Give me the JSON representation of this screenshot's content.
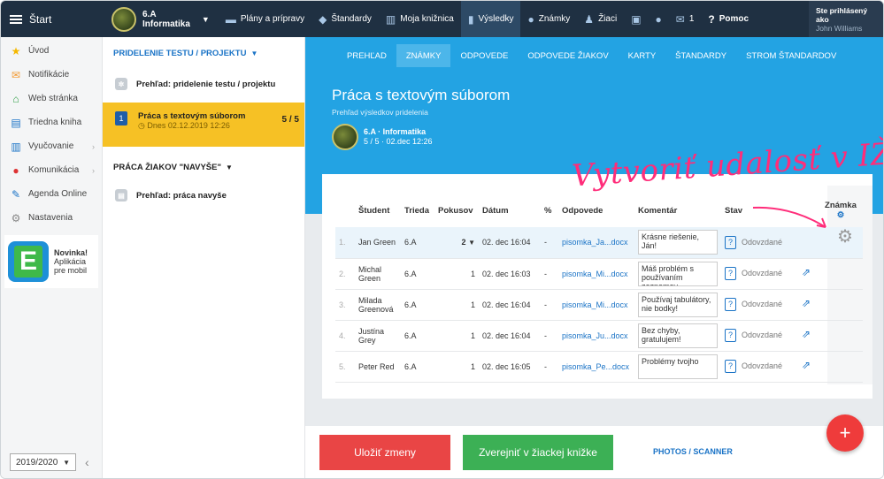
{
  "topbar": {
    "start_label": "Štart",
    "class_code": "6.A",
    "class_subject": "Informatika",
    "items": [
      {
        "label": "Plány a prípravy",
        "icon": "plans-icon"
      },
      {
        "label": "Štandardy",
        "icon": "shield-icon"
      },
      {
        "label": "Moja knižnica",
        "icon": "library-icon"
      },
      {
        "label": "Výsledky",
        "icon": "results-icon"
      },
      {
        "label": "Známky",
        "icon": "grades-icon"
      },
      {
        "label": "Žiaci",
        "icon": "students-icon"
      },
      {
        "label": "",
        "icon": "screen-icon"
      },
      {
        "label": "",
        "icon": "chat-icon"
      },
      {
        "label": "1",
        "icon": "mail-icon"
      },
      {
        "label": "Pomoc",
        "icon": "help-icon"
      }
    ],
    "user_line1": "Ste prihlásený ako",
    "user_line2": "John Williams"
  },
  "leftnav": {
    "items": [
      "Úvod",
      "Notifikácie",
      "Web stránka",
      "Triedna kniha",
      "Vyučovanie",
      "Komunikácia",
      "Agenda Online",
      "Nastavenia"
    ],
    "promo_logo": "E",
    "promo_title": "Novinka!",
    "promo_line1": "Aplikácia",
    "promo_line2": "pre mobil",
    "year": "2019/2020"
  },
  "middle": {
    "section1": "PRIDELENIE TESTU / PROJEKTU",
    "overview_label": "Prehľad: pridelenie testu / projektu",
    "active_number": "1",
    "active_title": "Práca s textovým súborom",
    "active_date": "Dnes 02.12.2019 12:26",
    "active_count": "5 / 5",
    "section2": "PRÁCA ŽIAKOV \"NAVYŠE\"",
    "extra_label": "Prehľad: práca navyše"
  },
  "main": {
    "tabs": [
      "PREHĽAD",
      "ZNÁMKY",
      "ODPOVEDE",
      "ODPOVEDE ŽIAKOV",
      "KARTY",
      "ŠTANDARDY",
      "STROM ŠTANDARDOV"
    ],
    "title": "Práca s textovým súborom",
    "subtitle": "Prehľad výsledkov pridelenia",
    "class_line": "6.A · Informatika",
    "class_sub": "5 / 5 · 02.dec 12:26",
    "headers": [
      "Študent",
      "Trieda",
      "Pokusov",
      "Dátum",
      "%",
      "Odpovede",
      "Komentár",
      "Stav",
      "Známka"
    ],
    "rows": [
      {
        "n": "1.",
        "student": "Jan Green",
        "trieda": "6.A",
        "pokusov": "2",
        "datum": "02. dec 16:04",
        "pct": "-",
        "odpoved": "pisomka_Ja...docx",
        "komentar": "Krásne riešenie, Ján!",
        "stav": "Odovzdané"
      },
      {
        "n": "2.",
        "student": "Michal Green",
        "trieda": "6.A",
        "pokusov": "1",
        "datum": "02. dec 16:03",
        "pct": "-",
        "odpoved": "pisomka_Mi...docx",
        "komentar": "Máš problém s používaním zoznamov.",
        "stav": "Odovzdané"
      },
      {
        "n": "3.",
        "student": "Milada Greenová",
        "trieda": "6.A",
        "pokusov": "1",
        "datum": "02. dec 16:04",
        "pct": "-",
        "odpoved": "pisomka_Mi...docx",
        "komentar": "Používaj tabulátory, nie bodky!",
        "stav": "Odovzdané"
      },
      {
        "n": "4.",
        "student": "Justína Grey",
        "trieda": "6.A",
        "pokusov": "1",
        "datum": "02. dec 16:04",
        "pct": "-",
        "odpoved": "pisomka_Ju...docx",
        "komentar": "Bez chyby, gratulujem!",
        "stav": "Odovzdané"
      },
      {
        "n": "5.",
        "student": "Peter Red",
        "trieda": "6.A",
        "pokusov": "1",
        "datum": "02. dec 16:05",
        "pct": "-",
        "odpoved": "pisomka_Pe...docx",
        "komentar": "Problémy tvojho",
        "stav": "Odovzdané"
      }
    ],
    "annotation": "Vytvoriť udalosť v IŽK",
    "save_label": "Uložiť zmeny",
    "publish_label": "Zverejniť v žiackej knižke",
    "photos_label": "PHOTOS / SCANNER",
    "fab_label": "+"
  }
}
